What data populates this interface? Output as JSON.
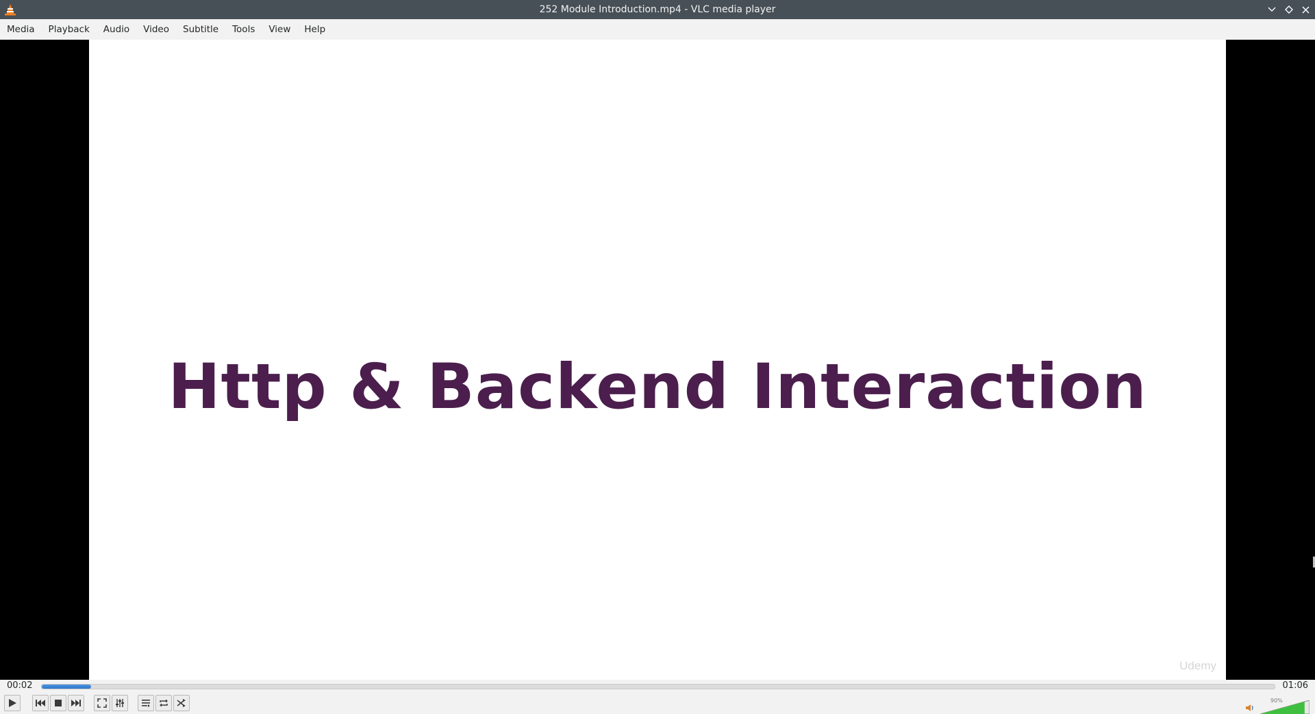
{
  "window": {
    "title": "252 Module Introduction.mp4 - VLC media player",
    "icons": [
      "vlc-cone-icon",
      "minimize-icon",
      "maximize-icon",
      "close-icon"
    ]
  },
  "menu": {
    "items": [
      {
        "label": "Media"
      },
      {
        "label": "Playback"
      },
      {
        "label": "Audio"
      },
      {
        "label": "Video"
      },
      {
        "label": "Subtitle"
      },
      {
        "label": "Tools"
      },
      {
        "label": "View"
      },
      {
        "label": "Help"
      }
    ]
  },
  "video": {
    "slide_title": "Http & Backend Interaction",
    "watermark": "Udemy"
  },
  "playback": {
    "elapsed": "00:02",
    "total": "01:06",
    "progress_fraction": 0.04
  },
  "controls": {
    "buttons": [
      "play-icon",
      "previous-icon",
      "stop-icon",
      "next-icon",
      "fullscreen-icon",
      "extended-settings-icon",
      "playlist-icon",
      "loop-icon",
      "shuffle-icon"
    ]
  },
  "volume": {
    "label": "90%",
    "level_fraction": 0.9
  },
  "colors": {
    "titlebar": "#475057",
    "slide_title": "#4b1e4d",
    "seek_fill": "#2e76c9",
    "volume_fill": "#3fbf3f"
  }
}
